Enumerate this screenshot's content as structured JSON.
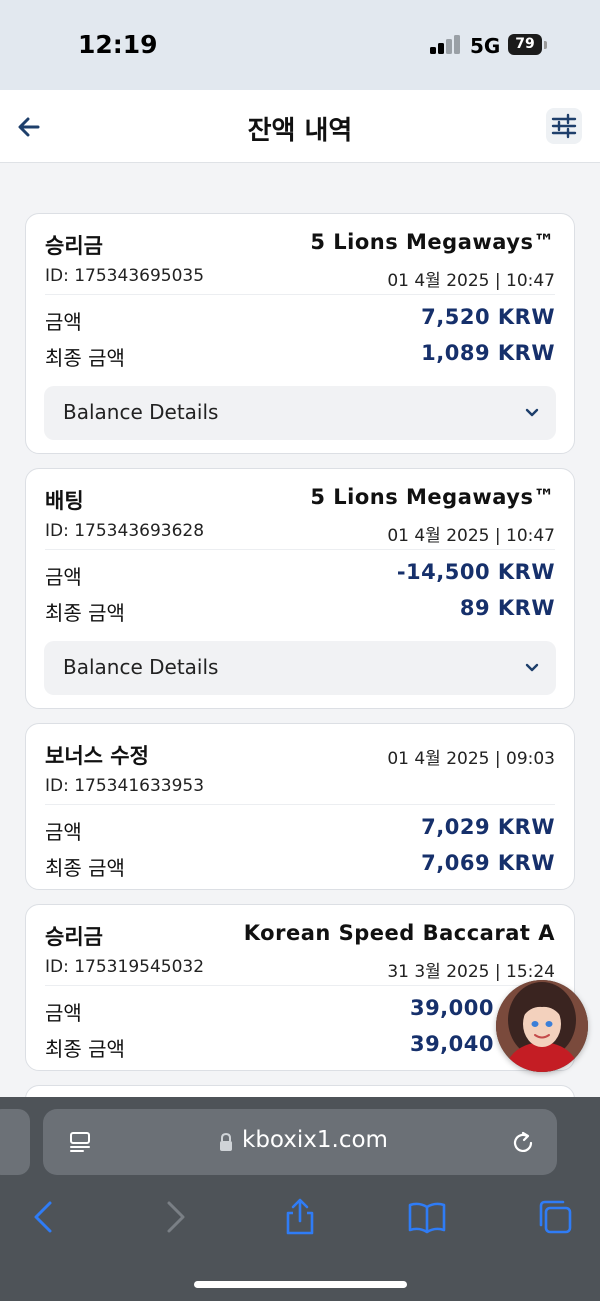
{
  "status_bar": {
    "time": "12:19",
    "network": "5G",
    "battery": "79"
  },
  "header": {
    "title": "잔액 내역"
  },
  "transactions": [
    {
      "type": "승리금",
      "game": "5 Lions Megaways™",
      "id": "ID: 175343695035",
      "datetime": "01 4월 2025 | 10:47",
      "amount_label": "금액",
      "amount": "7,520 KRW",
      "final_label": "최종 금액",
      "final_amount": "1,089 KRW",
      "details_label": "Balance Details"
    },
    {
      "type": "배팅",
      "game": "5 Lions Megaways™",
      "id": "ID: 175343693628",
      "datetime": "01 4월 2025 | 10:47",
      "amount_label": "금액",
      "amount": "-14,500 KRW",
      "final_label": "최종 금액",
      "final_amount": "89 KRW",
      "details_label": "Balance Details"
    },
    {
      "type": "보너스 수정",
      "id": "ID: 175341633953",
      "datetime": "01 4월 2025 | 09:03",
      "amount_label": "금액",
      "amount": "7,029 KRW",
      "final_label": "최종 금액",
      "final_amount": "7,069 KRW"
    },
    {
      "type": "승리금",
      "game": "Korean Speed Baccarat A",
      "id": "ID: 175319545032",
      "datetime": "31 3월 2025 | 15:24",
      "amount_label": "금액",
      "amount": "39,000",
      "final_label": "최종 금액",
      "final_amount": "39,040"
    }
  ],
  "browser": {
    "url": "kboxix1.com"
  },
  "colors": {
    "amount": "#16306b",
    "browser_accent": "#2f7cf6",
    "status_bar_bg": "#e2e8ef"
  },
  "icons": [
    "back-arrow-icon",
    "filter-sliders-icon",
    "chevron-down-icon",
    "reader-icon",
    "lock-icon",
    "reload-icon",
    "browser-back-icon",
    "browser-forward-icon",
    "share-icon",
    "bookmarks-icon",
    "tabs-icon"
  ]
}
